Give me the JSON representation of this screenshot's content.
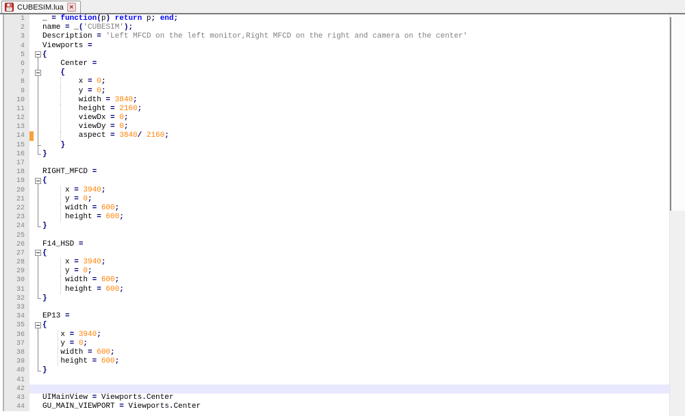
{
  "tab": {
    "title": "CUBESIM.lua",
    "close_glyph": "✕"
  },
  "icons": {
    "unsaved_changes": "red-floppy-disk",
    "tab_close": "x-in-box"
  },
  "colors": {
    "kw": "#0000FF",
    "op": "#000080",
    "num": "#FF8000",
    "str": "#808080",
    "caret_line": "#E8E8FF",
    "change_marker": "#F7A23B",
    "gutter_bg": "#E9E9E9",
    "gutter_text": "#848484",
    "tab_border": "#7A7A7A"
  },
  "editor": {
    "caret_line": 42,
    "change_marked_lines": [
      14
    ],
    "lines": [
      {
        "n": 1,
        "f": "",
        "t": [
          [
            "ti",
            "_ "
          ],
          [
            "to",
            "= "
          ],
          [
            "tk",
            "function"
          ],
          [
            "to",
            "("
          ],
          [
            "ti",
            "p"
          ],
          [
            "to",
            ")"
          ],
          [
            "ti",
            " "
          ],
          [
            "tk",
            "return"
          ],
          [
            "ti",
            " p"
          ],
          [
            "to",
            ";"
          ],
          [
            "ti",
            " "
          ],
          [
            "tk",
            "end"
          ],
          [
            "to",
            ";"
          ]
        ]
      },
      {
        "n": 2,
        "f": "",
        "t": [
          [
            "ti",
            "name "
          ],
          [
            "to",
            "= "
          ],
          [
            "ti",
            "_"
          ],
          [
            "to",
            "("
          ],
          [
            "ts",
            "'CUBESIM'"
          ],
          [
            "to",
            ");"
          ]
        ]
      },
      {
        "n": 3,
        "f": "",
        "t": [
          [
            "ti",
            "Description "
          ],
          [
            "to",
            "= "
          ],
          [
            "ts",
            "'Left MFCD on the left monitor,Right MFCD on the right and camera on the center'"
          ]
        ]
      },
      {
        "n": 4,
        "f": "",
        "t": [
          [
            "ti",
            "Viewports "
          ],
          [
            "to",
            "="
          ]
        ]
      },
      {
        "n": 5,
        "f": "b",
        "t": [
          [
            "to",
            "{"
          ]
        ]
      },
      {
        "n": 6,
        "f": "v",
        "t": [
          [
            "ti",
            "    Center "
          ],
          [
            "to",
            "="
          ]
        ]
      },
      {
        "n": 7,
        "f": "bc",
        "t": [
          [
            "ti",
            "    "
          ],
          [
            "to",
            "{"
          ]
        ]
      },
      {
        "n": 8,
        "f": "v",
        "g": 26,
        "t": [
          [
            "ti",
            "        x "
          ],
          [
            "to",
            "= "
          ],
          [
            "tn",
            "0"
          ],
          [
            "to",
            ";"
          ]
        ]
      },
      {
        "n": 9,
        "f": "v",
        "g": 26,
        "t": [
          [
            "ti",
            "        y "
          ],
          [
            "to",
            "= "
          ],
          [
            "tn",
            "0"
          ],
          [
            "to",
            ";"
          ]
        ]
      },
      {
        "n": 10,
        "f": "v",
        "g": 26,
        "t": [
          [
            "ti",
            "        width "
          ],
          [
            "to",
            "= "
          ],
          [
            "tn",
            "3840"
          ],
          [
            "to",
            ";"
          ]
        ]
      },
      {
        "n": 11,
        "f": "v",
        "g": 26,
        "t": [
          [
            "ti",
            "        height "
          ],
          [
            "to",
            "= "
          ],
          [
            "tn",
            "2160"
          ],
          [
            "to",
            ";"
          ]
        ]
      },
      {
        "n": 12,
        "f": "v",
        "g": 26,
        "t": [
          [
            "ti",
            "        viewDx "
          ],
          [
            "to",
            "= "
          ],
          [
            "tn",
            "0"
          ],
          [
            "to",
            ";"
          ]
        ]
      },
      {
        "n": 13,
        "f": "v",
        "g": 26,
        "t": [
          [
            "ti",
            "        viewDy "
          ],
          [
            "to",
            "= "
          ],
          [
            "tn",
            "0"
          ],
          [
            "to",
            ";"
          ]
        ]
      },
      {
        "n": 14,
        "f": "v",
        "g": 26,
        "t": [
          [
            "ti",
            "        aspect "
          ],
          [
            "to",
            "= "
          ],
          [
            "tn",
            "3840"
          ],
          [
            "to",
            "/ "
          ],
          [
            "tn",
            "2160"
          ],
          [
            "to",
            ";"
          ]
        ]
      },
      {
        "n": 15,
        "f": "t",
        "t": [
          [
            "ti",
            "    "
          ],
          [
            "to",
            "}"
          ]
        ]
      },
      {
        "n": 16,
        "f": "e",
        "t": [
          [
            "to",
            "}"
          ]
        ]
      },
      {
        "n": 17,
        "f": "",
        "t": []
      },
      {
        "n": 18,
        "f": "",
        "t": [
          [
            "ti",
            "RIGHT_MFCD "
          ],
          [
            "to",
            "="
          ]
        ]
      },
      {
        "n": 19,
        "f": "b",
        "t": [
          [
            "to",
            "{"
          ]
        ]
      },
      {
        "n": 20,
        "f": "v",
        "g": 26,
        "t": [
          [
            "ti",
            "     x "
          ],
          [
            "to",
            "= "
          ],
          [
            "tn",
            "3940"
          ],
          [
            "to",
            ";"
          ]
        ]
      },
      {
        "n": 21,
        "f": "v",
        "g": 26,
        "t": [
          [
            "ti",
            "     y "
          ],
          [
            "to",
            "= "
          ],
          [
            "tn",
            "0"
          ],
          [
            "to",
            ";"
          ]
        ]
      },
      {
        "n": 22,
        "f": "v",
        "g": 26,
        "t": [
          [
            "ti",
            "     width "
          ],
          [
            "to",
            "= "
          ],
          [
            "tn",
            "600"
          ],
          [
            "to",
            ";"
          ]
        ]
      },
      {
        "n": 23,
        "f": "v",
        "g": 26,
        "t": [
          [
            "ti",
            "     height "
          ],
          [
            "to",
            "= "
          ],
          [
            "tn",
            "600"
          ],
          [
            "to",
            ";"
          ]
        ]
      },
      {
        "n": 24,
        "f": "e",
        "t": [
          [
            "to",
            "}"
          ]
        ]
      },
      {
        "n": 25,
        "f": "",
        "t": []
      },
      {
        "n": 26,
        "f": "",
        "t": [
          [
            "ti",
            "F14_HSD "
          ],
          [
            "to",
            "="
          ]
        ]
      },
      {
        "n": 27,
        "f": "b",
        "t": [
          [
            "to",
            "{"
          ]
        ]
      },
      {
        "n": 28,
        "f": "v",
        "g": 26,
        "t": [
          [
            "ti",
            "     x "
          ],
          [
            "to",
            "= "
          ],
          [
            "tn",
            "3940"
          ],
          [
            "to",
            ";"
          ]
        ]
      },
      {
        "n": 29,
        "f": "v",
        "g": 26,
        "t": [
          [
            "ti",
            "     y "
          ],
          [
            "to",
            "= "
          ],
          [
            "tn",
            "0"
          ],
          [
            "to",
            ";"
          ]
        ]
      },
      {
        "n": 30,
        "f": "v",
        "g": 26,
        "t": [
          [
            "ti",
            "     width "
          ],
          [
            "to",
            "= "
          ],
          [
            "tn",
            "600"
          ],
          [
            "to",
            ";"
          ]
        ]
      },
      {
        "n": 31,
        "f": "v",
        "g": 26,
        "t": [
          [
            "ti",
            "     height "
          ],
          [
            "to",
            "= "
          ],
          [
            "tn",
            "600"
          ],
          [
            "to",
            ";"
          ]
        ]
      },
      {
        "n": 32,
        "f": "e",
        "t": [
          [
            "to",
            "}"
          ]
        ]
      },
      {
        "n": 33,
        "f": "",
        "t": []
      },
      {
        "n": 34,
        "f": "",
        "t": [
          [
            "ti",
            "EP13 "
          ],
          [
            "to",
            "="
          ]
        ]
      },
      {
        "n": 35,
        "f": "b",
        "t": [
          [
            "to",
            "{"
          ]
        ]
      },
      {
        "n": 36,
        "f": "v",
        "g": 22,
        "t": [
          [
            "ti",
            "    x "
          ],
          [
            "to",
            "= "
          ],
          [
            "tn",
            "3940"
          ],
          [
            "to",
            ";"
          ]
        ]
      },
      {
        "n": 37,
        "f": "v",
        "g": 22,
        "t": [
          [
            "ti",
            "    y "
          ],
          [
            "to",
            "= "
          ],
          [
            "tn",
            "0"
          ],
          [
            "to",
            ";"
          ]
        ]
      },
      {
        "n": 38,
        "f": "v",
        "g": 22,
        "t": [
          [
            "ti",
            "    width "
          ],
          [
            "to",
            "= "
          ],
          [
            "tn",
            "600"
          ],
          [
            "to",
            ";"
          ]
        ]
      },
      {
        "n": 39,
        "f": "v",
        "g": 22,
        "t": [
          [
            "ti",
            "    height "
          ],
          [
            "to",
            "= "
          ],
          [
            "tn",
            "600"
          ],
          [
            "to",
            ";"
          ]
        ]
      },
      {
        "n": 40,
        "f": "e",
        "t": [
          [
            "to",
            "}"
          ]
        ]
      },
      {
        "n": 41,
        "f": "",
        "t": []
      },
      {
        "n": 42,
        "f": "",
        "t": []
      },
      {
        "n": 43,
        "f": "",
        "t": [
          [
            "ti",
            "UIMainView "
          ],
          [
            "to",
            "= "
          ],
          [
            "ti",
            "Viewports"
          ],
          [
            "to",
            "."
          ],
          [
            "ti",
            "Center"
          ]
        ]
      },
      {
        "n": 44,
        "f": "",
        "t": [
          [
            "ti",
            "GU_MAIN_VIEWPORT "
          ],
          [
            "to",
            "= "
          ],
          [
            "ti",
            "Viewports"
          ],
          [
            "to",
            "."
          ],
          [
            "ti",
            "Center"
          ]
        ]
      }
    ]
  }
}
